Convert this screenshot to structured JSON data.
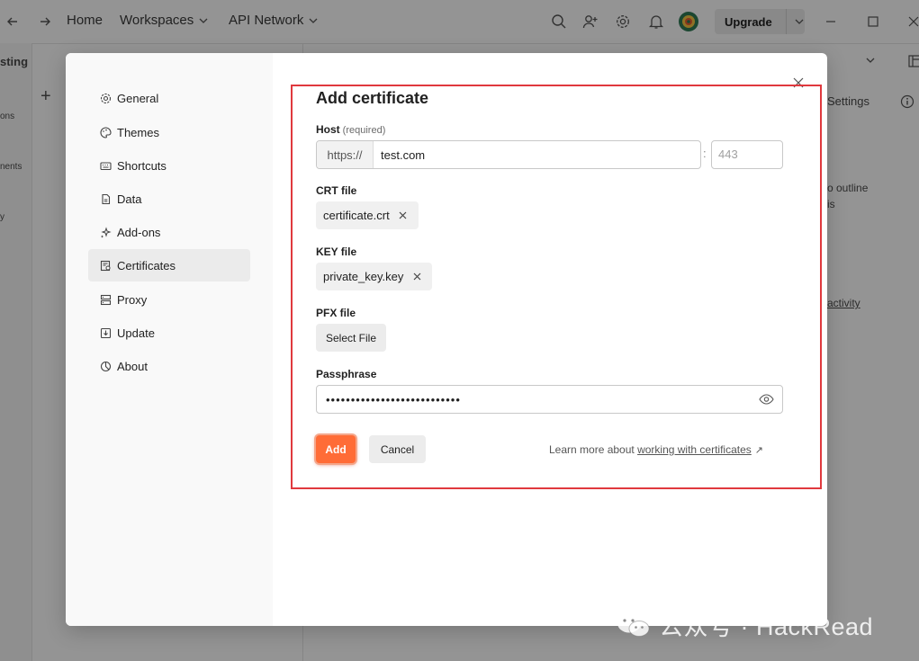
{
  "topbar": {
    "nav": {
      "home": "Home",
      "workspaces": "Workspaces",
      "api_network": "API Network"
    },
    "upgrade_label": "Upgrade",
    "icons": [
      "back-arrow-icon",
      "forward-arrow-icon",
      "search-icon",
      "invite-user-icon",
      "gear-icon",
      "bell-icon",
      "avatar"
    ]
  },
  "background": {
    "partial_texts": {
      "workspace": "sting",
      "collections": "ons",
      "environments": "nents",
      "history": "y",
      "settings": "Settings",
      "outline_1": "o outline",
      "outline_2": "is",
      "activity": "activity"
    }
  },
  "modal": {
    "nav": [
      {
        "label": "General",
        "icon": "gear-icon"
      },
      {
        "label": "Themes",
        "icon": "palette-icon"
      },
      {
        "label": "Shortcuts",
        "icon": "keyboard-icon"
      },
      {
        "label": "Data",
        "icon": "database-icon"
      },
      {
        "label": "Add-ons",
        "icon": "sparkle-icon"
      },
      {
        "label": "Certificates",
        "icon": "certificate-icon",
        "active": true
      },
      {
        "label": "Proxy",
        "icon": "proxy-icon"
      },
      {
        "label": "Update",
        "icon": "download-icon"
      },
      {
        "label": "About",
        "icon": "info-icon"
      }
    ],
    "form": {
      "title": "Add certificate",
      "host_label": "Host",
      "host_required": "(required)",
      "host_prefix": "https://",
      "host_value": "test.com",
      "colon": ":",
      "port_placeholder": "443",
      "crt_label": "CRT file",
      "crt_file": "certificate.crt",
      "key_label": "KEY file",
      "key_file": "private_key.key",
      "pfx_label": "PFX file",
      "select_file_label": "Select File",
      "passphrase_label": "Passphrase",
      "passphrase_value": "•••••••••••••••••••••••••••",
      "add_label": "Add",
      "cancel_label": "Cancel",
      "learn_prefix": "Learn more about ",
      "learn_link": "working with certificates",
      "learn_arrow": "↗"
    }
  },
  "watermark": "公众号 · HackRead",
  "colors": {
    "accent": "#ff6c37",
    "annotation": "#e0393e"
  }
}
